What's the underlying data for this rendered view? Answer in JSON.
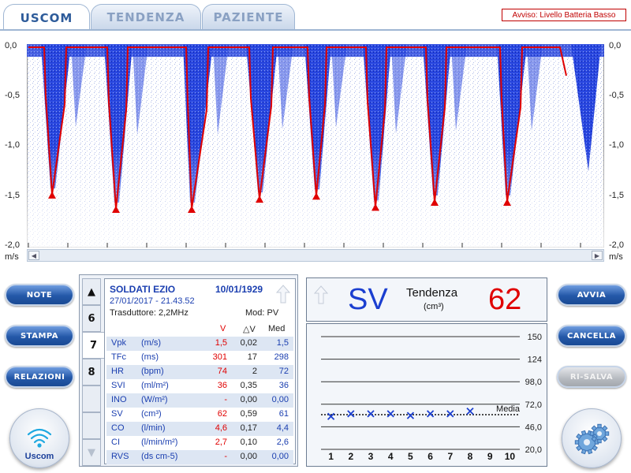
{
  "tabs": [
    {
      "label": "USCOM"
    },
    {
      "label": "TENDENZA"
    },
    {
      "label": "PAZIENTE"
    }
  ],
  "warning": "Avviso: Livello Batteria Basso",
  "doppler": {
    "y_ticks": [
      "0,0",
      "-0,5",
      "-1,0",
      "-1,5",
      "-2,0"
    ],
    "unit": "m/s",
    "trace_color": "#e00000",
    "signal_color": "#1f3fd8"
  },
  "buttons": {
    "note": "NOTE",
    "stampa": "STAMPA",
    "relazioni": "RELAZIONI",
    "avvia": "AVVIA",
    "cancella": "CANCELLA",
    "risalva": "RI-SALVA"
  },
  "logo": {
    "text": "Uscom"
  },
  "patient": {
    "name": "SOLDATI EZIO",
    "dob": "10/01/1929",
    "datetime": "27/01/2017 -  21.43.52",
    "transducer": "Trasduttore: 2,2MHz",
    "mode": "Mod: PV",
    "pages": [
      "6",
      "7",
      "8"
    ],
    "col_v": "V",
    "col_dv": "△V",
    "col_med": "Med",
    "rows": [
      {
        "name": "Vpk",
        "unit": "(m/s)",
        "v": "1,5",
        "dv": "0,02",
        "med": "1,5"
      },
      {
        "name": "TFc",
        "unit": "(ms)",
        "v": "301",
        "dv": "17",
        "med": "298"
      },
      {
        "name": "HR",
        "unit": "(bpm)",
        "v": "74",
        "dv": "2",
        "med": "72"
      },
      {
        "name": "SVI",
        "unit": "(ml/m²)",
        "v": "36",
        "dv": "0,35",
        "med": "36"
      },
      {
        "name": "INO",
        "unit": "(W/m²)",
        "v": "-",
        "dv": "0,00",
        "med": "0,00"
      },
      {
        "name": "SV",
        "unit": "(cm³)",
        "v": "62",
        "dv": "0,59",
        "med": "61"
      },
      {
        "name": "CO",
        "unit": "(l/min)",
        "v": "4,6",
        "dv": "0,17",
        "med": "4,4"
      },
      {
        "name": "CI",
        "unit": "(l/min/m²)",
        "v": "2,7",
        "dv": "0,10",
        "med": "2,6"
      },
      {
        "name": "RVS",
        "unit": "(ds cm-5)",
        "v": "-",
        "dv": "0,00",
        "med": "0,00"
      }
    ]
  },
  "sv_panel": {
    "label": "SV",
    "trend": "Tendenza",
    "unit": "(cm³)",
    "value": "62"
  },
  "chart_data": {
    "type": "scatter",
    "x": [
      1,
      2,
      3,
      4,
      5,
      6,
      7,
      8
    ],
    "values": [
      58,
      61,
      61,
      61,
      59,
      61,
      61,
      64
    ],
    "x_tick_labels": [
      "1",
      "2",
      "3",
      "4",
      "5",
      "6",
      "7",
      "8",
      "9",
      "10"
    ],
    "y_tick_labels": [
      "150",
      "124",
      "98,0",
      "72,0",
      "46,0",
      "20,0"
    ],
    "ylim": [
      20,
      150
    ],
    "xlim": [
      0.5,
      10.5
    ],
    "media_label": "Media",
    "media_value": 60,
    "marker_color": "#1b3fd0"
  }
}
